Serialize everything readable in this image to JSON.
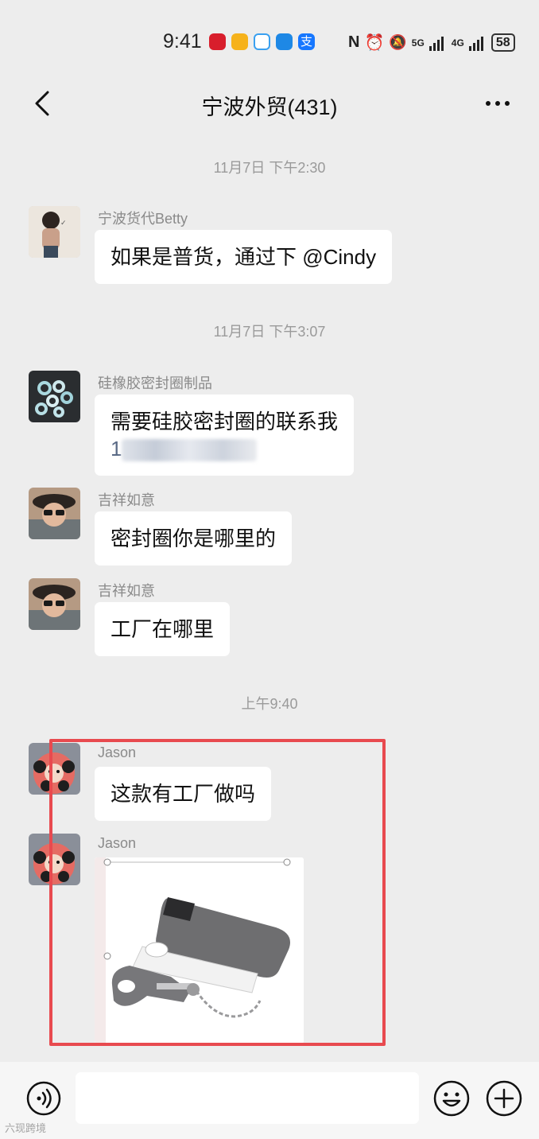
{
  "status_bar": {
    "time": "9:41",
    "network_1": "5G",
    "network_2": "4G",
    "battery": "58"
  },
  "header": {
    "title": "宁波外贸(431)"
  },
  "messages": [
    {
      "type": "timestamp",
      "text": "11月7日 下午2:30"
    },
    {
      "type": "text",
      "sender": "宁波货代Betty",
      "text": "如果是普货，通过下  @Cindy"
    },
    {
      "type": "timestamp",
      "text": "11月7日 下午3:07"
    },
    {
      "type": "text",
      "sender": "硅橡胶密封圈制品",
      "text": "需要硅胶密封圈的联系我",
      "text2": "1"
    },
    {
      "type": "text",
      "sender": "吉祥如意",
      "text": "密封圈你是哪里的"
    },
    {
      "type": "text",
      "sender": "吉祥如意",
      "text": "工厂在哪里"
    },
    {
      "type": "timestamp",
      "text": "上午9:40"
    },
    {
      "type": "text",
      "sender": "Jason",
      "text": "这款有工厂做吗"
    },
    {
      "type": "image",
      "sender": "Jason",
      "image_desc": "door-lock-product-photo"
    }
  ],
  "input_bar": {
    "voice_icon": "voice-icon",
    "emoji_icon": "emoji-icon",
    "plus_icon": "plus-icon"
  },
  "watermark": "六现跨境",
  "colors": {
    "background": "#ededed",
    "bubble": "#ffffff",
    "highlight": "#e84a4f",
    "timestamp": "#9a9a9a"
  }
}
